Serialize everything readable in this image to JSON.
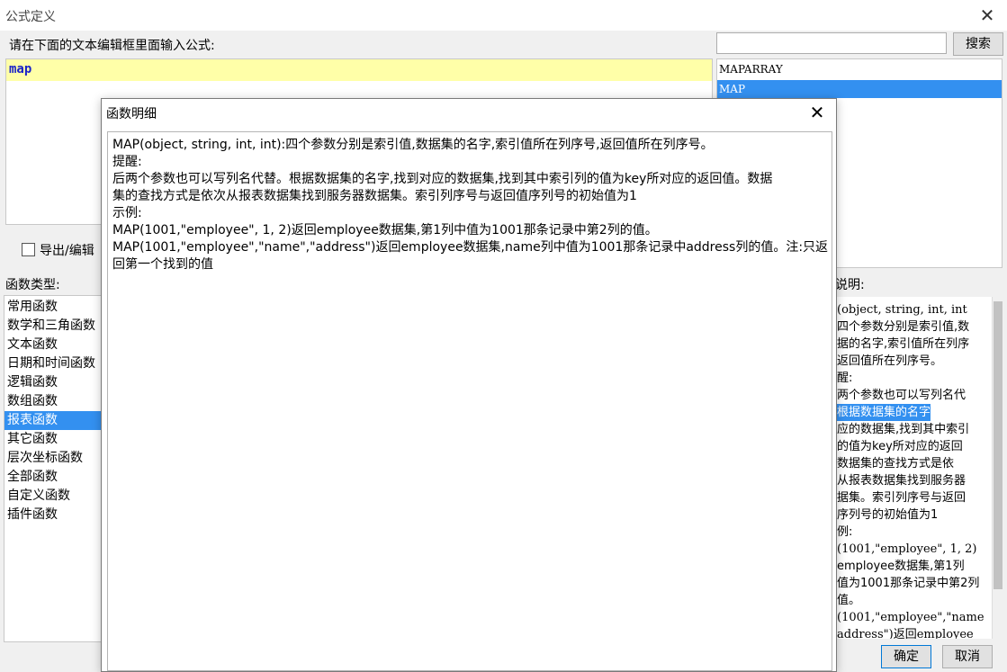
{
  "window": {
    "title": "公式定义",
    "close_glyph": "✕"
  },
  "editor": {
    "prompt": "请在下面的文本编辑框里面输入公式:",
    "formula": "map"
  },
  "search": {
    "placeholder": "",
    "button": "搜索"
  },
  "function_list": {
    "items": [
      "MAPARRAY",
      "MAP"
    ],
    "selected": "MAP"
  },
  "export": {
    "label": "导出/编辑"
  },
  "types": {
    "label": "函数类型:",
    "items": [
      "常用函数",
      "数学和三角函数",
      "文本函数",
      "日期和时间函数",
      "逻辑函数",
      "数组函数",
      "报表函数",
      "其它函数",
      "层次坐标函数",
      "全部函数",
      "自定义函数",
      "插件函数"
    ],
    "selected": "报表函数"
  },
  "description": {
    "label": "说明:",
    "lines": [
      "(object, string, int, int",
      "四个参数分别是索引值,数",
      "据的名字,索引值所在列序",
      "返回值所在列序号。",
      "醒:",
      "两个参数也可以写列名代",
      "根据数据集的名字,找到",
      "应的数据集,找到其中索引",
      "的值为key所对应的返回",
      "数据集的查找方式是依",
      "从报表数据集找到服务器",
      "据集。索引列序号与返回",
      "序列号的初始值为1",
      "例:",
      "(1001,\"employee\", 1, 2)",
      "employee数据集,第1列",
      "值为1001那条记录中第2列",
      "值。",
      "(1001,\"employee\",\"name",
      "address\")返回employee"
    ],
    "highlight_fragment": "根据数据集的名字"
  },
  "buttons": {
    "ok": "确定",
    "cancel": "取消"
  },
  "dialog": {
    "title": "函数明细",
    "close_glyph": "✕",
    "lines": [
      "MAP(object, string, int, int):四个参数分别是索引值,数据集的名字,索引值所在列序号,返回值所在列序号。",
      "提醒:",
      "后两个参数也可以写列名代替。根据数据集的名字,找到对应的数据集,找到其中索引列的值为key所对应的返回值。数据",
      "集的查找方式是依次从报表数据集找到服务器数据集。索引列序号与返回值序列号的初始值为1",
      "示例:",
      "MAP(1001,\"employee\", 1, 2)返回employee数据集,第1列中值为1001那条记录中第2列的值。",
      "MAP(1001,\"employee\",\"name\",\"address\")返回employee数据集,name列中值为1001那条记录中address列的值。注:只返",
      "回第一个找到的值"
    ]
  },
  "colors": {
    "selection": "#3390f0",
    "formula_line": "#ffffa8",
    "formula_text": "#1a22c8"
  }
}
